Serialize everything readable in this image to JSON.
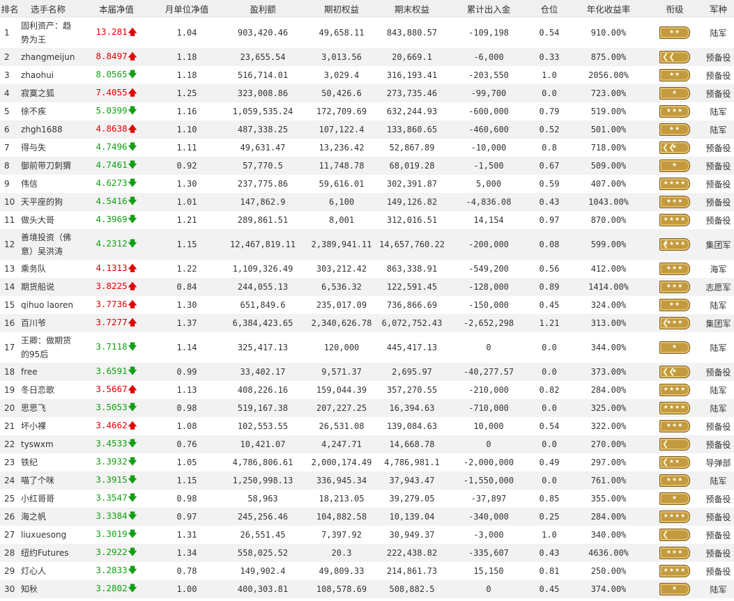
{
  "headers": [
    "排名",
    "选手名称",
    "本届净值",
    "月单位净值",
    "盈利额",
    "期初权益",
    "期末权益",
    "累计出入金",
    "仓位",
    "年化收益率",
    "衔级",
    "军种"
  ],
  "rows": [
    {
      "rank": "1",
      "name": "固利资产：趋势为王",
      "nav": "13.281",
      "dir": "up",
      "month": "1.04",
      "profit": "903,420.46",
      "start": "49,658.11",
      "end": "843,880.57",
      "flow": "-109,198",
      "pos": "0.54",
      "annual": "910.00%",
      "stars": "★★",
      "chev": "",
      "branch": "陆军",
      "tall": true
    },
    {
      "rank": "2",
      "name": "zhangmeijun",
      "nav": "8.8497",
      "dir": "up",
      "month": "1.18",
      "profit": "23,655.54",
      "start": "3,013.56",
      "end": "20,669.1",
      "flow": "-6,000",
      "pos": "0.33",
      "annual": "875.00%",
      "stars": "",
      "chev": "❮❮",
      "branch": "预备役",
      "tall": false
    },
    {
      "rank": "3",
      "name": "zhaohui",
      "nav": "8.0565",
      "dir": "down",
      "month": "1.18",
      "profit": "516,714.01",
      "start": "3,029.4",
      "end": "316,193.41",
      "flow": "-203,550",
      "pos": "1.0",
      "annual": "2056.00%",
      "stars": "★★",
      "chev": "",
      "branch": "预备役",
      "tall": false
    },
    {
      "rank": "4",
      "name": "寂寞之狐",
      "nav": "7.4055",
      "dir": "up",
      "month": "1.25",
      "profit": "323,008.86",
      "start": "50,426.6",
      "end": "273,735.46",
      "flow": "-99,700",
      "pos": "0.0",
      "annual": "723.00%",
      "stars": "★",
      "chev": "",
      "branch": "预备役",
      "tall": false
    },
    {
      "rank": "5",
      "name": "徐不疾",
      "nav": "5.0399",
      "dir": "down",
      "month": "1.16",
      "profit": "1,059,535.24",
      "start": "172,709.69",
      "end": "632,244.93",
      "flow": "-600,000",
      "pos": "0.79",
      "annual": "519.00%",
      "stars": "★★★",
      "chev": "",
      "branch": "陆军",
      "tall": false
    },
    {
      "rank": "6",
      "name": "zhgh1688",
      "nav": "4.8638",
      "dir": "up",
      "month": "1.10",
      "profit": "487,338.25",
      "start": "107,122.4",
      "end": "133,860.65",
      "flow": "-460,600",
      "pos": "0.52",
      "annual": "501.00%",
      "stars": "★★",
      "chev": "",
      "branch": "陆军",
      "tall": false
    },
    {
      "rank": "7",
      "name": "得与失",
      "nav": "4.7496",
      "dir": "down",
      "month": "1.11",
      "profit": "49,631.47",
      "start": "13,236.42",
      "end": "52,867.89",
      "flow": "-10,000",
      "pos": "0.8",
      "annual": "718.00%",
      "stars": "★",
      "chev": "❮❮",
      "branch": "预备役",
      "tall": false
    },
    {
      "rank": "8",
      "name": "御前带刀刺猬",
      "nav": "4.7461",
      "dir": "down",
      "month": "0.92",
      "profit": "57,770.5",
      "start": "11,748.78",
      "end": "68,019.28",
      "flow": "-1,500",
      "pos": "0.67",
      "annual": "509.00%",
      "stars": "★",
      "chev": "",
      "branch": "预备役",
      "tall": false
    },
    {
      "rank": "9",
      "name": "伟信",
      "nav": "4.6273",
      "dir": "down",
      "month": "1.30",
      "profit": "237,775.86",
      "start": "59,616.01",
      "end": "302,391.87",
      "flow": "5,000",
      "pos": "0.59",
      "annual": "407.00%",
      "stars": "★★★★",
      "chev": "",
      "branch": "预备役",
      "tall": false
    },
    {
      "rank": "10",
      "name": "天平座的狗",
      "nav": "4.5416",
      "dir": "down",
      "month": "1.01",
      "profit": "147,862.9",
      "start": "6,100",
      "end": "149,126.82",
      "flow": "-4,836.08",
      "pos": "0.43",
      "annual": "1043.00%",
      "stars": "★★★",
      "chev": "",
      "branch": "预备役",
      "tall": false
    },
    {
      "rank": "11",
      "name": "做头大哥",
      "nav": "4.3969",
      "dir": "down",
      "month": "1.21",
      "profit": "289,861.51",
      "start": "8,001",
      "end": "312,016.51",
      "flow": "14,154",
      "pos": "0.97",
      "annual": "870.00%",
      "stars": "★★★★",
      "chev": "",
      "branch": "预备役",
      "tall": false
    },
    {
      "rank": "12",
      "name": "善境投资（佛意）吴洪涛",
      "nav": "4.2312",
      "dir": "down",
      "month": "1.15",
      "profit": "12,467,819.11",
      "start": "2,389,941.11",
      "end": "14,657,760.22",
      "flow": "-200,000",
      "pos": "0.08",
      "annual": "599.00%",
      "stars": "★★★★",
      "chev": "❮",
      "branch": "集团军",
      "tall": true
    },
    {
      "rank": "13",
      "name": "乘务队",
      "nav": "4.1313",
      "dir": "up",
      "month": "1.22",
      "profit": "1,109,326.49",
      "start": "303,212.42",
      "end": "863,338.91",
      "flow": "-549,200",
      "pos": "0.56",
      "annual": "412.00%",
      "stars": "★★★",
      "chev": "",
      "branch": "海军",
      "tall": false
    },
    {
      "rank": "14",
      "name": "期货船说",
      "nav": "3.8225",
      "dir": "up",
      "month": "0.84",
      "profit": "244,055.13",
      "start": "6,536.32",
      "end": "122,591.45",
      "flow": "-128,000",
      "pos": "0.89",
      "annual": "1414.00%",
      "stars": "★★★",
      "chev": "",
      "branch": "志愿军",
      "tall": false
    },
    {
      "rank": "15",
      "name": "qihuo laoren",
      "nav": "3.7736",
      "dir": "up",
      "month": "1.30",
      "profit": "651,849.6",
      "start": "235,017.09",
      "end": "736,866.69",
      "flow": "-150,000",
      "pos": "0.45",
      "annual": "324.00%",
      "stars": "★★",
      "chev": "",
      "branch": "陆军",
      "tall": false
    },
    {
      "rank": "16",
      "name": "百川爷",
      "nav": "3.7277",
      "dir": "up",
      "month": "1.37",
      "profit": "6,384,423.65",
      "start": "2,340,626.78",
      "end": "6,072,752.43",
      "flow": "-2,652,298",
      "pos": "1.21",
      "annual": "313.00%",
      "stars": "★★★",
      "chev": "❮",
      "branch": "集团军",
      "tall": false
    },
    {
      "rank": "17",
      "name": "王卿：做期货的95后",
      "nav": "3.7118",
      "dir": "down",
      "month": "1.14",
      "profit": "325,417.13",
      "start": "120,000",
      "end": "445,417.13",
      "flow": "0",
      "pos": "0.0",
      "annual": "344.00%",
      "stars": "★",
      "chev": "",
      "branch": "陆军",
      "tall": true
    },
    {
      "rank": "18",
      "name": "free",
      "nav": "3.6591",
      "dir": "down",
      "month": "0.99",
      "profit": "33,402.17",
      "start": "9,571.37",
      "end": "2,695.97",
      "flow": "-40,277.57",
      "pos": "0.0",
      "annual": "373.00%",
      "stars": "★",
      "chev": "❮❮",
      "branch": "预备役",
      "tall": false
    },
    {
      "rank": "19",
      "name": "冬日恋歌",
      "nav": "3.5667",
      "dir": "up",
      "month": "1.13",
      "profit": "408,226.16",
      "start": "159,044.39",
      "end": "357,270.55",
      "flow": "-210,000",
      "pos": "0.82",
      "annual": "284.00%",
      "stars": "★★★★",
      "chev": "",
      "branch": "陆军",
      "tall": false
    },
    {
      "rank": "20",
      "name": "思思飞",
      "nav": "3.5053",
      "dir": "down",
      "month": "0.98",
      "profit": "519,167.38",
      "start": "207,227.25",
      "end": "16,394.63",
      "flow": "-710,000",
      "pos": "0.0",
      "annual": "325.00%",
      "stars": "★★★★",
      "chev": "",
      "branch": "陆军",
      "tall": false
    },
    {
      "rank": "21",
      "name": "坏小裸",
      "nav": "3.4662",
      "dir": "up",
      "month": "1.08",
      "profit": "102,553.55",
      "start": "26,531.08",
      "end": "139,084.63",
      "flow": "10,000",
      "pos": "0.54",
      "annual": "322.00%",
      "stars": "★★★",
      "chev": "",
      "branch": "预备役",
      "tall": false
    },
    {
      "rank": "22",
      "name": "tyswxm",
      "nav": "3.4533",
      "dir": "down",
      "month": "0.76",
      "profit": "10,421.07",
      "start": "4,247.71",
      "end": "14,668.78",
      "flow": "0",
      "pos": "0.0",
      "annual": "270.00%",
      "stars": "",
      "chev": "❮",
      "branch": "预备役",
      "tall": false
    },
    {
      "rank": "23",
      "name": "铁纪",
      "nav": "3.3932",
      "dir": "down",
      "month": "1.05",
      "profit": "4,786,806.61",
      "start": "2,000,174.49",
      "end": "4,786,981.1",
      "flow": "-2,000,000",
      "pos": "0.49",
      "annual": "297.00%",
      "stars": "★★",
      "chev": "❮",
      "branch": "导弹部",
      "tall": false
    },
    {
      "rank": "24",
      "name": "喵了个咪",
      "nav": "3.3915",
      "dir": "down",
      "month": "1.15",
      "profit": "1,250,998.13",
      "start": "336,945.34",
      "end": "37,943.47",
      "flow": "-1,550,000",
      "pos": "0.0",
      "annual": "761.00%",
      "stars": "★★★",
      "chev": "",
      "branch": "陆军",
      "tall": false
    },
    {
      "rank": "25",
      "name": "小红哥哥",
      "nav": "3.3547",
      "dir": "down",
      "month": "0.98",
      "profit": "58,963",
      "start": "18,213.05",
      "end": "39,279.05",
      "flow": "-37,897",
      "pos": "0.85",
      "annual": "355.00%",
      "stars": "★",
      "chev": "",
      "branch": "预备役",
      "tall": false
    },
    {
      "rank": "26",
      "name": "海之帆",
      "nav": "3.3384",
      "dir": "down",
      "month": "0.97",
      "profit": "245,256.46",
      "start": "104,882.58",
      "end": "10,139.04",
      "flow": "-340,000",
      "pos": "0.25",
      "annual": "284.00%",
      "stars": "★★★★",
      "chev": "",
      "branch": "预备役",
      "tall": false
    },
    {
      "rank": "27",
      "name": "liuxuesong",
      "nav": "3.3019",
      "dir": "down",
      "month": "1.31",
      "profit": "26,551.45",
      "start": "7,397.92",
      "end": "30,949.37",
      "flow": "-3,000",
      "pos": "1.0",
      "annual": "340.00%",
      "stars": "",
      "chev": "❮",
      "branch": "预备役",
      "tall": false
    },
    {
      "rank": "28",
      "name": "纽约Futures",
      "nav": "3.2922",
      "dir": "down",
      "month": "1.34",
      "profit": "558,025.52",
      "start": "20.3",
      "end": "222,438.82",
      "flow": "-335,607",
      "pos": "0.43",
      "annual": "4636.00%",
      "stars": "★★★",
      "chev": "",
      "branch": "预备役",
      "tall": false
    },
    {
      "rank": "29",
      "name": "灯心人",
      "nav": "3.2833",
      "dir": "down",
      "month": "0.78",
      "profit": "149,902.4",
      "start": "49,809.33",
      "end": "214,861.73",
      "flow": "15,150",
      "pos": "0.81",
      "annual": "250.00%",
      "stars": "★★★★",
      "chev": "",
      "branch": "预备役",
      "tall": false
    },
    {
      "rank": "30",
      "name": "知秋",
      "nav": "3.2802",
      "dir": "down",
      "month": "1.00",
      "profit": "400,303.81",
      "start": "108,578.69",
      "end": "508,882.5",
      "flow": "0",
      "pos": "0.45",
      "annual": "374.00%",
      "stars": "★",
      "chev": "",
      "branch": "陆军",
      "tall": false
    }
  ],
  "colors": {
    "up": "#e00000",
    "down": "#11a011",
    "badge": "#c49a3e"
  },
  "icons": {
    "up": "arrow-up-icon",
    "down": "arrow-down-icon",
    "badge": "rank-insignia-icon"
  }
}
